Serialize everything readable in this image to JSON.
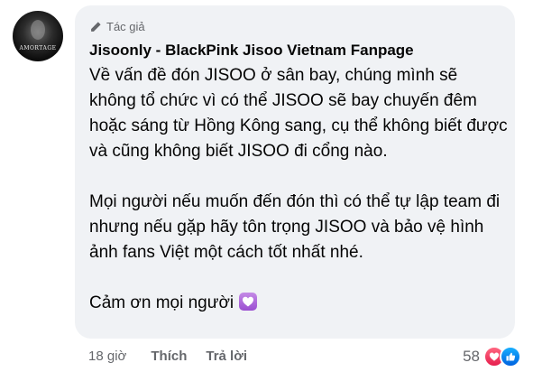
{
  "avatar": {
    "text": "AMORTAGE"
  },
  "comment": {
    "badge_label": "Tác giả",
    "author": "Jisoonly - BlackPink Jisoo Vietnam Fanpage",
    "paragraphs": [
      "Về vấn đề đón JISOO ở sân bay, chúng mình sẽ không tổ chức vì có thể JISOO sẽ bay chuyến đêm hoặc sáng từ Hồng Kông sang, cụ thể không biết được và cũng không biết JISOO đi cổng nào.",
      "Mọi người nếu muốn đến đón thì có thể tự lập team đi nhưng nếu gặp hãy tôn trọng JISOO và bảo vệ hình ảnh fans Việt một cách tốt nhất nhé.",
      "Cảm ơn mọi người"
    ]
  },
  "actions": {
    "time": "18 giờ",
    "like_label": "Thích",
    "reply_label": "Trả lời"
  },
  "reactions": {
    "count": "58",
    "types": [
      "love",
      "like"
    ],
    "colors": {
      "love": "#f33e58",
      "like": "#0866ff"
    }
  }
}
